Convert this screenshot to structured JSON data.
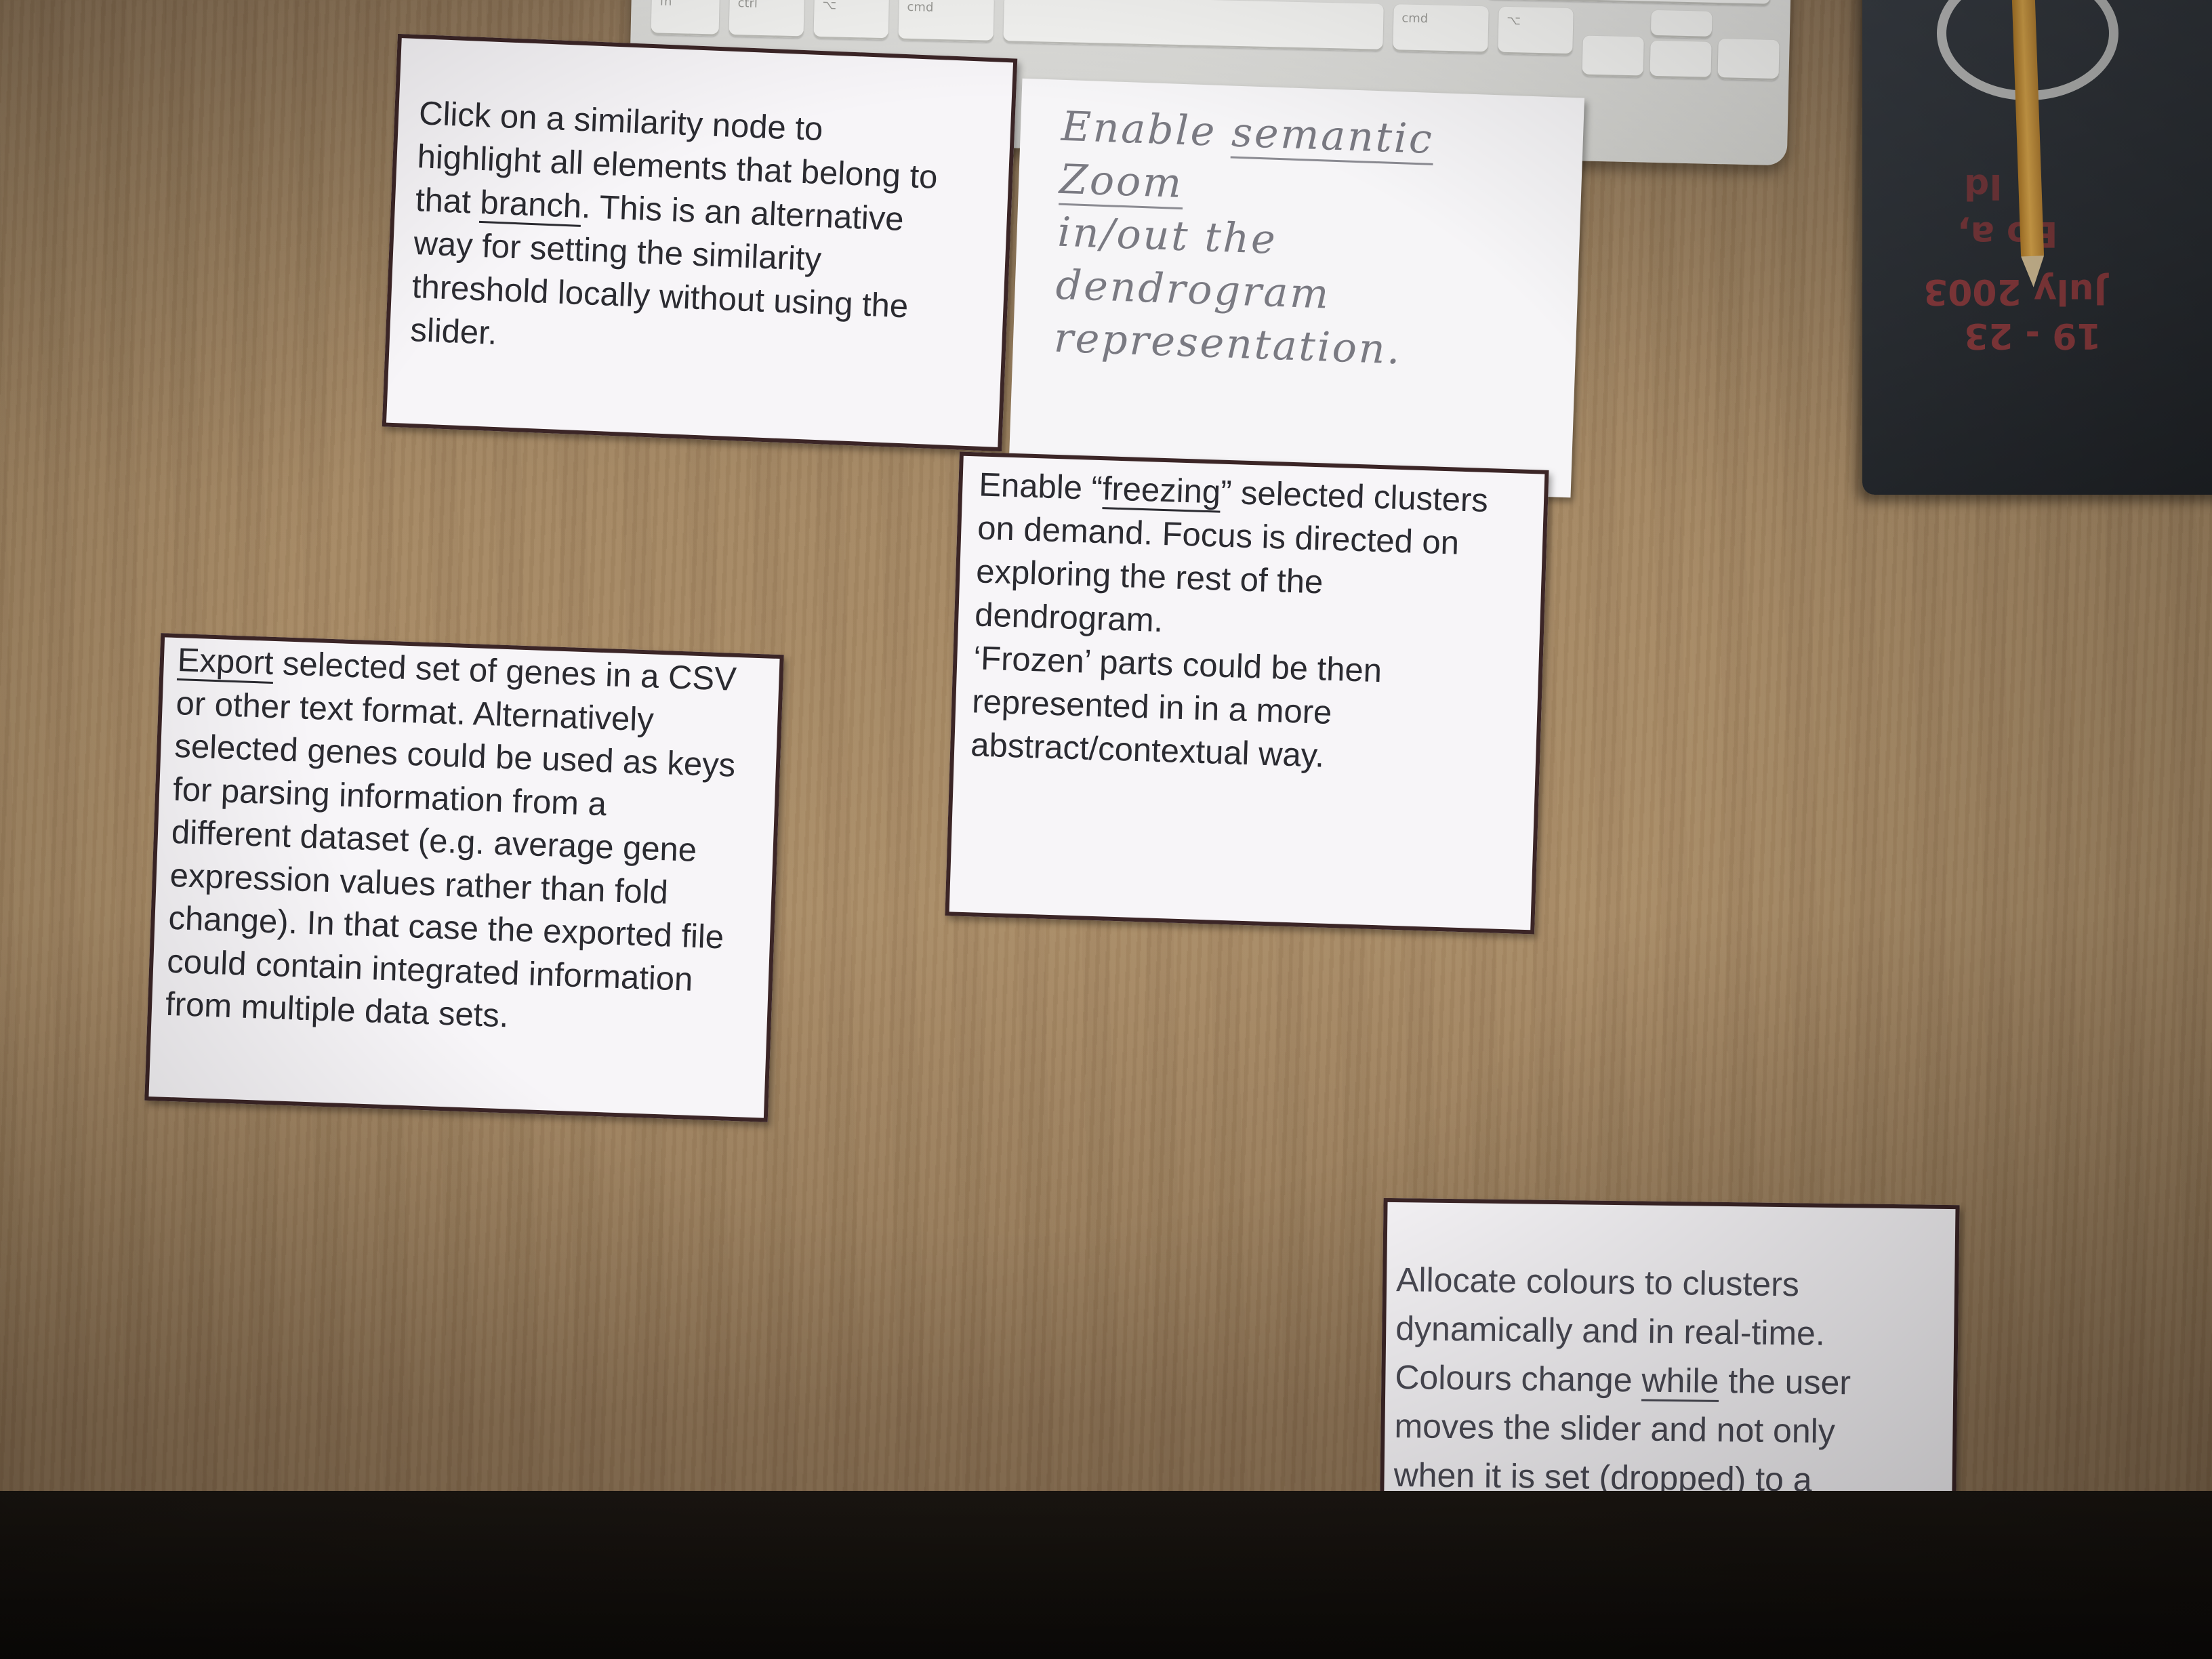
{
  "keyboard": {
    "keys": [
      "fn",
      "ctrl",
      "⌥",
      "cmd",
      "⌘",
      "⌘",
      "cmd",
      "⌥"
    ]
  },
  "book": {
    "lines": [
      "19 - 23",
      "July 2003",
      "Bo a,",
      "Id"
    ]
  },
  "cards": {
    "similarity_node": {
      "before": "Click on a similarity node to\nhighlight all elements that belong to\nthat ",
      "underlined": "branch",
      "after": ". This is an alternative\nway for setting the similarity\nthreshold locally without using the\nslider."
    },
    "semantic_zoom": {
      "line1": "Enable ",
      "underlined": "semantic Zoom",
      "line2": "in/out the dendrogram\nrepresentation."
    },
    "freezing": {
      "before": "Enable “",
      "underlined": "freezing",
      "after": "” selected clusters\non demand. Focus is directed on\nexploring the rest of the\ndendrogram.\n‘Frozen’ parts could be then\nrepresented in in a more\nabstract/contextual way."
    },
    "export": {
      "underlined": "Export",
      "after": " selected set of genes in a CSV\nor other text format. Alternatively\nselected genes could be used as keys\nfor parsing information from a\ndifferent dataset (e.g. average gene\nexpression values rather than fold\nchange). In that case the exported file\ncould contain integrated information\nfrom multiple data sets."
    },
    "colours": {
      "before": "Allocate colours to clusters\ndynamically and in real-time.\nColours change ",
      "underlined": "while",
      "after": " the user\nmoves the slider and not only\nwhen it is set (dropped) to a\nsimilarity threshold value."
    }
  }
}
